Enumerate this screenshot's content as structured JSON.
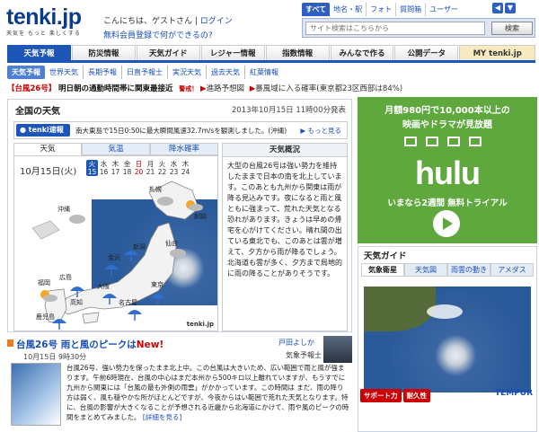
{
  "header": {
    "logo": "tenki.jp",
    "tagline": "天気を もっと 楽しくする",
    "greeting": "こんにちは、ゲストさん",
    "login": "ログイン",
    "member_link": "無料会員登録で何ができるの?"
  },
  "search": {
    "tabs": [
      "すべて",
      "地名・駅",
      "フォト",
      "質問箱",
      "ユーザー"
    ],
    "placeholder": "サイト検索はこちらから",
    "button": "検索",
    "prev": "◀",
    "next": "▼"
  },
  "main_nav": [
    "天気予報",
    "防災情報",
    "天気ガイド",
    "レジャー情報",
    "指数情報",
    "みんなで作る",
    "公開データ",
    "MY tenki.jp"
  ],
  "sub_nav": [
    "天気予報",
    "世界天気",
    "長期予報",
    "日直予報士",
    "実況天気",
    "過去天気",
    "紅葉情報"
  ],
  "news": {
    "tag": "【台風26号】",
    "headline": "明日朝の通勤時間帯に関東最接近",
    "alert": "警戒！",
    "link1": "進路予想図",
    "link2": "暴風域に入る確率(東京都23区西部は84%)"
  },
  "forecast": {
    "title": "全国の天気",
    "date": "2013年10月15日 11時00分発表",
    "flash_tag": "tenki速報",
    "flash_text": "南大東島で15日0:50に最大瞬間風速32.7m/sを観測しました。(沖縄)",
    "flash_more": "もっと見る",
    "tabs": [
      "天気",
      "気温",
      "降水確率"
    ],
    "map_date": "10月15日(火)",
    "days": [
      {
        "w": "火",
        "d": "15"
      },
      {
        "w": "水",
        "d": "16"
      },
      {
        "w": "木",
        "d": "17"
      },
      {
        "w": "金",
        "d": "18"
      },
      {
        "w": "土",
        "d": "19"
      },
      {
        "w": "日",
        "d": "20"
      },
      {
        "w": "月",
        "d": "21"
      },
      {
        "w": "火",
        "d": "22"
      },
      {
        "w": "水",
        "d": "23"
      },
      {
        "w": "木",
        "d": "24"
      }
    ],
    "cities": {
      "sapporo": "札幌",
      "okinawa": "沖縄",
      "kushiro": "釧路",
      "sendai": "仙台",
      "niigata": "新潟",
      "kanazawa": "金沢",
      "hiroshima": "広島",
      "fukuoka": "福岡",
      "osaka": "大阪",
      "nagoya": "名古屋",
      "tokyo": "東京",
      "kochi": "高知",
      "kagoshima": "鹿児島"
    },
    "map_logo": "tenki.jp",
    "summary_title": "天気概況",
    "summary_text": "大型の台風26号は強い勢力を維持したままで日本の南を北上しています。このあとも九州から関東は雨が降る見込みです。夜になると雨と風ともに強まって、荒れた天気となる恐れがあります。きょうは早めの帰宅を心がけてください。晴れ間の出ている東北でも、このあとは雲が増えて、夕方から雨が降るでしょう。北海道も雲が多く、夕方まで局地的に雨の降ることがありそうです。"
  },
  "article": {
    "title": "台風26号 雨と風のピークは",
    "new": "New!",
    "date": "10月15日 9時30分",
    "author": "戸田よしか",
    "role": "気象予報士",
    "body": "台風26号、強い勢力を保ったまま北上中。この台風は大きいため、広い範囲で雨と風が強まります。午前6時現在、台風の中心はまだ本州から500キロ以上離れていますが、もうすでに九州から関東には「台風の最も外側の雨雲」がかかっています。この時間は まだ、雨の降り方は弱く、風も穏やかな所がほとんどですが、今夜からはい範囲で荒れた天気となります。特に、台風の影響が大きくなることが予想される近畿から北海道にかけて、雨や風のピークの時間をまとめてみました。",
    "more": "[詳細を見る]"
  },
  "ad": {
    "line1": "月額980円で10,000本以上の",
    "line2": "映画やドラマが見放題",
    "logo": "hulu",
    "line3": "いまなら2週間 無料トライアル"
  },
  "guide": {
    "title": "天気ガイド",
    "tabs": [
      "気象衛星",
      "天気図",
      "雨雲の動き",
      "アメダス"
    ],
    "badges": [
      "サポート力",
      "耐久性"
    ],
    "sponsor": "TEMPUR"
  },
  "colors": {
    "brand": "#1e56b8",
    "alert": "#cc0000",
    "ad_green": "#5fa83d"
  }
}
